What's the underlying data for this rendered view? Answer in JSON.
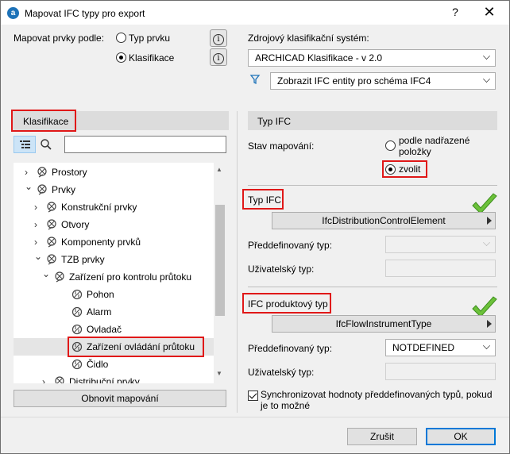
{
  "window": {
    "title": "Mapovat IFC typy pro export",
    "help": "?",
    "close": "✕"
  },
  "map_by": {
    "label": "Mapovat prvky podle:",
    "option_type": "Typ prvku",
    "option_class": "Klasifikace",
    "selected": "Klasifikace"
  },
  "source_system": {
    "label": "Zdrojový klasifikační systém:",
    "value": "ARCHICAD Klasifikace - v 2.0"
  },
  "filter": {
    "value": "Zobrazit IFC entity pro schéma IFC4"
  },
  "left_panel": {
    "header": "Klasifikace",
    "search_placeholder": "",
    "tree": [
      {
        "label": "Prostory",
        "level": 1,
        "expanded": false
      },
      {
        "label": "Prvky",
        "level": 1,
        "expanded": true
      },
      {
        "label": "Konstrukční prvky",
        "level": 2,
        "expanded": false
      },
      {
        "label": "Otvory",
        "level": 2,
        "expanded": false
      },
      {
        "label": "Komponenty prvků",
        "level": 2,
        "expanded": false
      },
      {
        "label": "TZB prvky",
        "level": 2,
        "expanded": true
      },
      {
        "label": "Zařízení pro kontrolu průtoku",
        "level": 3,
        "expanded": true
      },
      {
        "label": "Pohon",
        "level": 4,
        "expanded": null
      },
      {
        "label": "Alarm",
        "level": 4,
        "expanded": null
      },
      {
        "label": "Ovladač",
        "level": 4,
        "expanded": null
      },
      {
        "label": "Zařízení ovládání průtoku",
        "level": 4,
        "expanded": null,
        "selected": true
      },
      {
        "label": "Čidlo",
        "level": 4,
        "expanded": null
      },
      {
        "label": "Distribuční prvky",
        "level": 3,
        "expanded": false
      }
    ],
    "refresh_button": "Obnovit mapování"
  },
  "right_panel": {
    "header": "Typ IFC",
    "mapping_state_label": "Stav mapování:",
    "mapping_option_parent": "podle nadřazené položky",
    "mapping_option_choose": "zvolit",
    "mapping_selected": "zvolit",
    "ifc_type": {
      "title": "Typ IFC",
      "entity": "IfcDistributionControlElement",
      "predefined_label": "Předdefinovaný typ:",
      "predefined_value": "",
      "user_label": "Uživatelský typ:",
      "user_value": ""
    },
    "ifc_product_type": {
      "title": "IFC produktový typ",
      "entity": "IfcFlowInstrumentType",
      "predefined_label": "Předdefinovaný typ:",
      "predefined_value": "NOTDEFINED",
      "user_label": "Uživatelský typ:",
      "user_value": ""
    },
    "sync_label": "Synchronizovat hodnoty předdefinovaných typů, pokud je to možné",
    "sync_checked": true
  },
  "footer": {
    "cancel": "Zrušit",
    "ok": "OK"
  },
  "colors": {
    "highlight_red": "#e01818",
    "check_green": "#6cc13a",
    "primary_blue": "#0078d7"
  }
}
